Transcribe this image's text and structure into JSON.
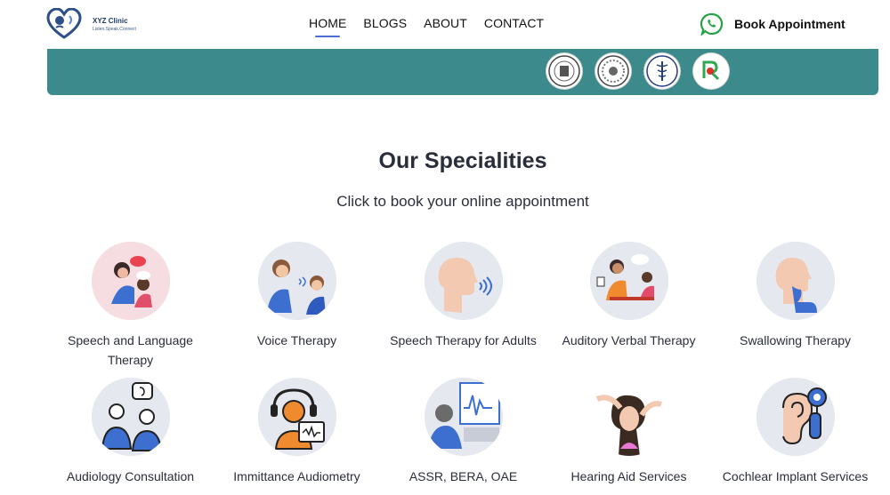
{
  "brand": {
    "name": "XYZ Clinic",
    "tagline": "Listen.Speak.Connect"
  },
  "nav": {
    "items": [
      "HOME",
      "BLOGS",
      "ABOUT",
      "CONTACT"
    ],
    "active": "HOME"
  },
  "cta": {
    "label": "Book Appointment",
    "icon": "whatsapp-icon"
  },
  "accreditation": {
    "seals": [
      "seal-emblem-1",
      "seal-emblem-2",
      "medical-caduceus-emblem",
      "rci-emblem"
    ]
  },
  "colors": {
    "banner": "#3d8a8c",
    "accent": "#4a6fd0",
    "whatsapp": "#25a244"
  },
  "specialities": {
    "title": "Our Specialities",
    "subtitle": "Click to book your online appointment",
    "items": [
      {
        "label": "Speech and Language Therapy",
        "icon": "speech-language-therapy-illustration"
      },
      {
        "label": "Voice Therapy",
        "icon": "voice-therapy-illustration"
      },
      {
        "label": "Speech Therapy for Adults",
        "icon": "adult-speech-therapy-illustration"
      },
      {
        "label": "Auditory Verbal Therapy",
        "icon": "auditory-verbal-therapy-illustration"
      },
      {
        "label": "Swallowing Therapy",
        "icon": "swallowing-therapy-illustration"
      },
      {
        "label": "Audiology Consultation",
        "icon": "audiology-consultation-illustration"
      },
      {
        "label": "Immittance Audiometry",
        "icon": "immittance-audiometry-illustration"
      },
      {
        "label": "ASSR, BERA, OAE",
        "icon": "assr-bera-oae-illustration"
      },
      {
        "label": "Hearing Aid Services",
        "icon": "hearing-aid-illustration"
      },
      {
        "label": "Cochlear Implant Services",
        "icon": "cochlear-implant-illustration"
      }
    ]
  }
}
